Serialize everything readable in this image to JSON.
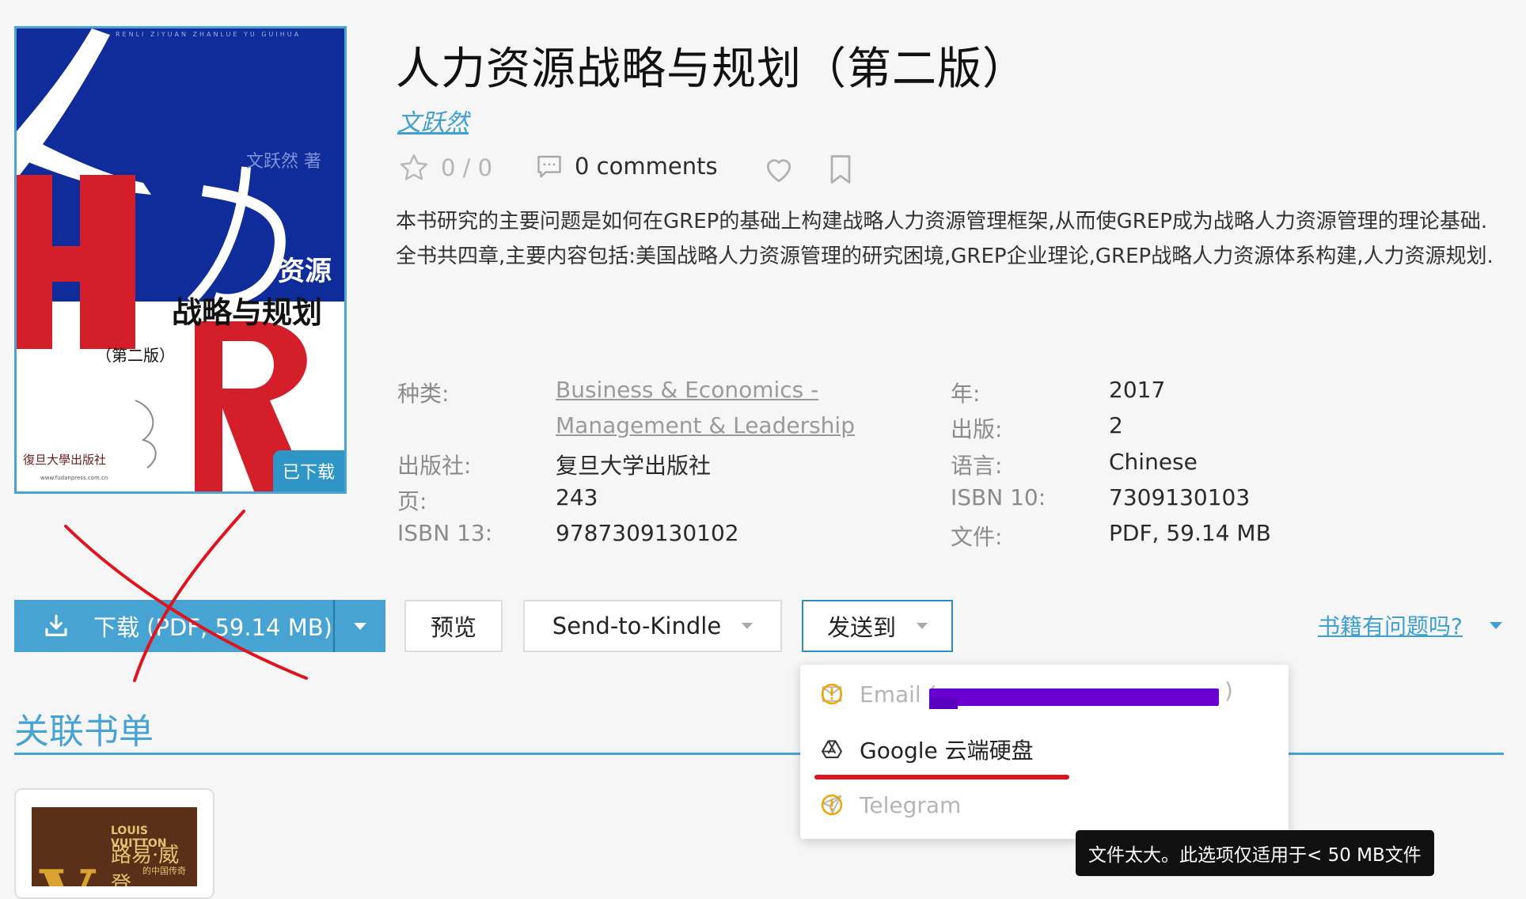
{
  "book": {
    "title": "人力资源战略与规划（第二版）",
    "author": "文跃然",
    "rating": "0 / 0",
    "comments": "0 comments",
    "description": "本书研究的主要问题是如何在GREP的基础上构建战略人力资源管理框架,从而使GREP成为战略人力资源管理的理论基础.全书共四章,主要内容包括:美国战略人力资源管理的研究困境,GREP企业理论,GREP战略人力资源体系构建,人力资源规划."
  },
  "cover": {
    "series_line": "RENLI ZIYUAN ZHANLUE YU GUIHUA",
    "author_line": "文跃然 著",
    "title_part1": "资源",
    "title_part2": "战略与规划",
    "edition": "（第二版）",
    "publisher": "復旦大學出版社",
    "publisher_url": "www.fudanpress.com.cn",
    "downloaded_badge": "已下载"
  },
  "details": {
    "left": [
      {
        "label": "种类:",
        "value": "Business & Economics - ",
        "value2": "Management & Leadership"
      },
      {
        "label": "出版社:",
        "value": "复旦大学出版社"
      },
      {
        "label": "页:",
        "value": "243"
      },
      {
        "label": "ISBN 13:",
        "value": "9787309130102"
      }
    ],
    "right": [
      {
        "label": "年:",
        "value": "2017"
      },
      {
        "label": "出版:",
        "value": "2"
      },
      {
        "label": "语言:",
        "value": "Chinese"
      },
      {
        "label": "ISBN 10:",
        "value": "7309130103"
      },
      {
        "label": "文件:",
        "value": "PDF, 59.14 MB"
      }
    ]
  },
  "actions": {
    "download": "下载 (PDF, 59.14 MB)",
    "preview": "预览",
    "kindle": "Send-to-Kindle",
    "send_to": "发送到",
    "report": "书籍有问题吗?"
  },
  "send_menu": {
    "email": "Email (",
    "email_close": ")",
    "google": "Google 云端硬盘",
    "telegram": "Telegram"
  },
  "tooltip": "文件太大。此选项仅适用于< 50 MB文件",
  "related": {
    "heading": "关联书单",
    "card_brand": "LOUIS VUITTON",
    "card_title": "路易·威登",
    "card_subtitle": "的中国传奇"
  },
  "colors": {
    "accent": "#46a3d2",
    "annotation_red": "#e0141e",
    "redaction": "#6900d1"
  }
}
